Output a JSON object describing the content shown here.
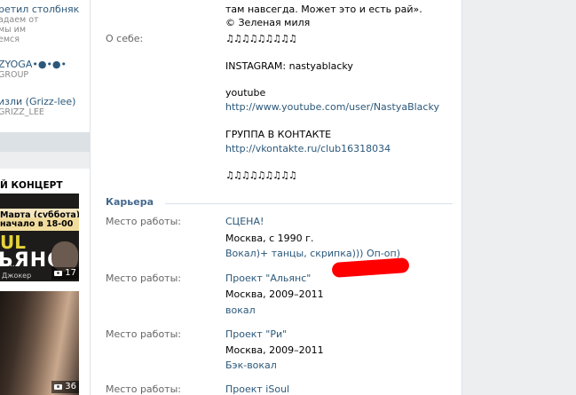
{
  "left": {
    "group1": {
      "name": "ретил столбняк",
      "sub1": "адаем от",
      "sub2": "мы им",
      "sub3": "емся"
    },
    "group2": {
      "name": "ZYOGA•●•●•",
      "sub": "GROUP"
    },
    "group3": {
      "name": "изли (Grizz-lee)",
      "sub": "GRIZZ_LEE"
    },
    "thumb1": {
      "header": "Й КОНЦЕРТ",
      "date": "Марта (суббота)",
      "time": "начало в 18-00",
      "big1": "UL",
      "big2": "ЬЯНС",
      "small": "в к...",
      "caption": "Джокер",
      "photos": "17"
    },
    "thumb2": {
      "photos": "36"
    }
  },
  "profile": {
    "intro1": "там навсегда. Может это и есть рай».",
    "intro2": "© Зеленая миля",
    "about_label": "О себе:",
    "notes": "♫♫♫♫♫♫♫♫♫",
    "instagram": "INSTAGRAM: nastyablacky",
    "youtube_label": "youtube",
    "youtube_link": "http://www.youtube.com/user/NastyaBlacky",
    "group_label": "ГРУППА В КОНТАКТЕ",
    "group_link": "http://vkontakte.ru/club16318034",
    "notes2": "♫♫♫♫♫♫♫♫♫"
  },
  "career": {
    "heading": "Карьера",
    "entries": [
      {
        "label": "Место работы:",
        "name": "СЦЕНА!",
        "details": "Москва, с 1990 г.",
        "role": "Вокал)+ танцы, скрипка))) Оп-оп)"
      },
      {
        "label": "Место работы:",
        "name": "Проект \"Альянс\"",
        "details": "Москва, 2009–2011",
        "role": "вокал"
      },
      {
        "label": "Место работы:",
        "name": "Проект \"Ри\"",
        "details": "Москва, 2009–2011",
        "role": "Бэк-вокал"
      },
      {
        "label": "Место работы:",
        "name": "Проект iSoul"
      }
    ]
  },
  "colors": {
    "link": "#2b587a",
    "label": "#666666",
    "background": "#edeef0",
    "redaction": "#ff0000"
  }
}
